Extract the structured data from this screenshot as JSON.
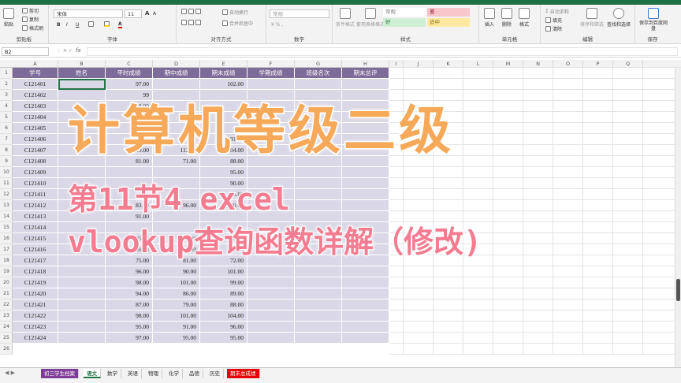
{
  "ribbon": {
    "clipboard": {
      "paste": "粘贴",
      "cut": "剪切",
      "copy": "复制",
      "format_painter": "格式刷",
      "group": "剪贴板"
    },
    "font": {
      "name": "宋体",
      "size": "11",
      "group": "字体"
    },
    "alignment": {
      "wrap": "自动换行",
      "merge": "合并后居中",
      "group": "对齐方式"
    },
    "number": {
      "format": "常规",
      "group": "数字"
    },
    "styles": {
      "cond_format": "条件格式",
      "table_format": "套用表格格式",
      "normal": "常规",
      "bad": "差",
      "good": "好",
      "neutral": "适中",
      "group": "样式"
    },
    "cells": {
      "insert": "插入",
      "delete": "删除",
      "format": "格式",
      "group": "单元格"
    },
    "editing": {
      "autosum": "自动求和",
      "fill": "填充",
      "clear": "清除",
      "sort": "排序和筛选",
      "find": "查找和选择",
      "group": "编辑"
    },
    "save": {
      "label": "保存到百度网盘",
      "group": "保存"
    }
  },
  "formula_bar": {
    "name_box": "B2",
    "fx": "fx",
    "content": ""
  },
  "columns": [
    "A",
    "B",
    "C",
    "D",
    "E",
    "F",
    "G",
    "H",
    "I",
    "J",
    "K",
    "L",
    "M",
    "N",
    "O",
    "P",
    "Q"
  ],
  "table": {
    "headers": [
      "学号",
      "姓名",
      "平时成绩",
      "期中成绩",
      "期末成绩",
      "学期成绩",
      "班级名次",
      "期末总评"
    ],
    "rows": [
      {
        "id": "C121401",
        "c": "97.00",
        "d": "",
        "e": "102.00"
      },
      {
        "id": "C121402",
        "c": "99",
        "d": "",
        "e": ""
      },
      {
        "id": "C121403",
        "c": "98.00",
        "d": "",
        "e": ""
      },
      {
        "id": "C121404",
        "c": "87.00",
        "d": "",
        "e": ""
      },
      {
        "id": "C121405",
        "c": "103",
        "d": "",
        "e": ""
      },
      {
        "id": "C121406",
        "c": "96.00",
        "d": "",
        "e": "91.00"
      },
      {
        "id": "C121407",
        "c": "109.00",
        "d": "112.00",
        "e": "104.00"
      },
      {
        "id": "C121408",
        "c": "81.00",
        "d": "71.00",
        "e": "88.00"
      },
      {
        "id": "C121409",
        "c": "",
        "d": "",
        "e": "95.00"
      },
      {
        "id": "C121410",
        "c": "",
        "d": "",
        "e": "90.00"
      },
      {
        "id": "C121411",
        "c": "",
        "d": "",
        "e": "95.00"
      },
      {
        "id": "C121412",
        "c": "83.00",
        "d": "96.00",
        "e": "90.00"
      },
      {
        "id": "C121413",
        "c": "91.00",
        "d": "",
        "e": ""
      },
      {
        "id": "C121414",
        "c": "",
        "d": "",
        "e": ""
      },
      {
        "id": "C121415",
        "c": "95.00",
        "d": "88.00",
        "e": "98.00"
      },
      {
        "id": "C121416",
        "c": "98.00",
        "d": "118.00",
        "e": "101.00"
      },
      {
        "id": "C121417",
        "c": "75.00",
        "d": "81.00",
        "e": "72.00"
      },
      {
        "id": "C121418",
        "c": "96.00",
        "d": "90.00",
        "e": "101.00"
      },
      {
        "id": "C121419",
        "c": "98.00",
        "d": "101.00",
        "e": "99.00"
      },
      {
        "id": "C121420",
        "c": "94.00",
        "d": "86.00",
        "e": "89.00"
      },
      {
        "id": "C121421",
        "c": "87.00",
        "d": "79.00",
        "e": "88.00"
      },
      {
        "id": "C121422",
        "c": "98.00",
        "d": "101.00",
        "e": "104.00"
      },
      {
        "id": "C121423",
        "c": "95.00",
        "d": "91.00",
        "e": "96.00"
      },
      {
        "id": "C121424",
        "c": "97.00",
        "d": "95.00",
        "e": "95.00"
      }
    ]
  },
  "overlay": {
    "title": "计算机等级二级",
    "subtitle_line1": "第11节4 excel",
    "subtitle_line2": "vlookup查询函数详解（修改)"
  },
  "tabs": [
    "初三学生档案",
    "语文",
    "数学",
    "英语",
    "物理",
    "化学",
    "品德",
    "历史",
    "期末总成绩"
  ],
  "colors": {
    "header": "#7d6b99",
    "data": "#dad8e6",
    "title": "#f7a95a",
    "subtitle": "#f47c91",
    "accent": "#217346"
  }
}
